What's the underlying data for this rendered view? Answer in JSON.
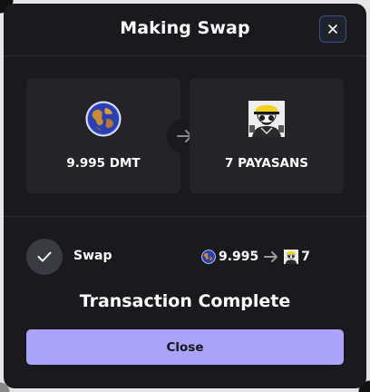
{
  "modal": {
    "title": "Making Swap",
    "close_icon": "close-icon"
  },
  "swap": {
    "from": {
      "label": "9.995 DMT",
      "icon": "globe-token-icon"
    },
    "to": {
      "label": "7 PAYASANS",
      "icon": "payasans-nft-icon"
    },
    "arrow_icon": "arrow-right-icon"
  },
  "steps": [
    {
      "label": "Swap",
      "status_icon": "check-icon",
      "from_amount": "9.995",
      "to_amount": "7"
    }
  ],
  "status_text": "Transaction Complete",
  "close_button_label": "Close",
  "colors": {
    "modal_bg": "#1a1a1e",
    "panel_bg": "#232328",
    "accent": "#a9a4f9",
    "close_border": "#3a4e8e"
  }
}
